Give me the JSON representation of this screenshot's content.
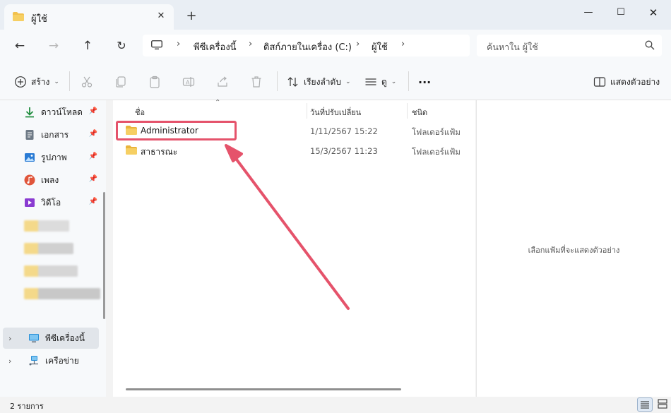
{
  "window": {
    "tab_title": "ผู้ใช้",
    "new_tab": "+",
    "close_tab": "✕",
    "minimize": "—",
    "maximize": "☐",
    "close": "✕"
  },
  "address_bar": {
    "crumbs": [
      "พีซีเครื่องนี้",
      "ดิสก์ภายในเครื่อง (C:)",
      "ผู้ใช้"
    ],
    "search_placeholder": "ค้นหาใน ผู้ใช้"
  },
  "command_bar": {
    "new_label": "สร้าง",
    "sort_label": "เรียงลำดับ",
    "view_label": "ดู",
    "more_label": "···",
    "details_label": "แสดงตัวอย่าง"
  },
  "sidebar": {
    "quick_access": [
      {
        "label": "ดาวน์โหลด",
        "icon": "download-icon",
        "color": "#1f8c3e"
      },
      {
        "label": "เอกสาร",
        "icon": "document-icon",
        "color": "#6e7a86"
      },
      {
        "label": "รูปภาพ",
        "icon": "pictures-icon",
        "color": "#2a7bd4"
      },
      {
        "label": "เพลง",
        "icon": "music-icon",
        "color": "#e0553a"
      },
      {
        "label": "วิดีโอ",
        "icon": "video-icon",
        "color": "#8a3bd1"
      }
    ],
    "pin": "📌",
    "this_pc": "พีซีเครื่องนี้",
    "network": "เครือข่าย"
  },
  "file_list": {
    "columns": [
      "ชื่อ",
      "วันที่ปรับเปลี่ยน",
      "ชนิด"
    ],
    "rows": [
      {
        "name": "Administrator",
        "date": "1/11/2567 15:22",
        "type": "โฟลเดอร์แฟ้ม"
      },
      {
        "name": "สาธารณะ",
        "date": "15/3/2567 11:23",
        "type": "โฟลเดอร์แฟ้ม"
      }
    ]
  },
  "preview": {
    "message": "เลือกแฟ้มที่จะแสดงตัวอย่าง"
  },
  "status": {
    "item_count": "2 รายการ"
  },
  "colors": {
    "highlight": "#e5536b",
    "folder": "#f2c14e"
  }
}
